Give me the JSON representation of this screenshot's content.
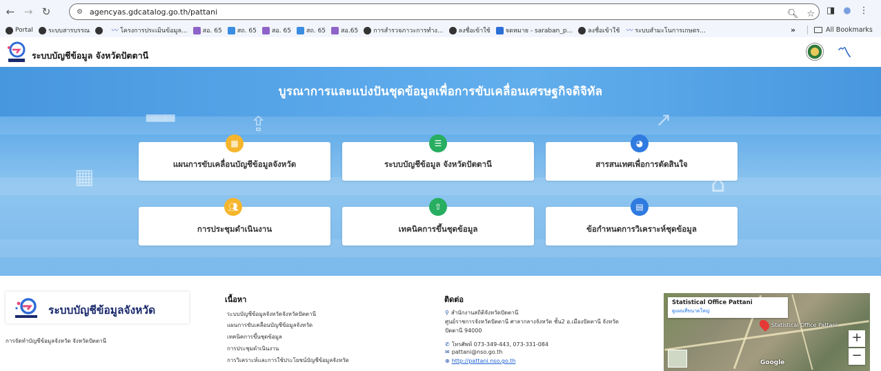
{
  "browser": {
    "url": "agencyas.gdcatalog.go.th/pattani",
    "bookmarks": [
      "Portal",
      "ระบบสารบรรณ",
      "",
      "โครงการประเมินข้อมูล...",
      "สอ. 65",
      "สถ. 65",
      "สอ. 65",
      "สถ. 65",
      "สอ.65",
      "การสำรวจภาวะการทำง...",
      "ลงชื่อเข้าใช้",
      "จดหมาย - saraban_p...",
      "ลงชื่อเข้าใช้",
      "ระบบสำมะโนการเกษตร..."
    ],
    "more_label": "»",
    "all_bookmarks": "All Bookmarks"
  },
  "header": {
    "site_title": "ระบบบัญชีข้อมูล จังหวัดปัตตานี"
  },
  "hero": {
    "title": "บูรณาการและแบ่งปันชุดข้อมูลเพื่อการขับเคลื่อนเศรษฐกิจดิจิทัล",
    "cards": [
      {
        "label": "แผนการขับเคลื่อนบัญชีข้อมูลจังหวัด",
        "icon": "calendar-icon",
        "color": "#f5b62d"
      },
      {
        "label": "ระบบบัญชีข้อมูล จังหวัดปัตตานี",
        "icon": "list-icon",
        "color": "#27ae60"
      },
      {
        "label": "สารสนเทศเพื่อการตัดสินใจ",
        "icon": "pie-chart-icon",
        "color": "#2f7be0"
      },
      {
        "label": "การประชุมดำเนินงาน",
        "icon": "users-icon",
        "color": "#f5b62d"
      },
      {
        "label": "เทคนิคการขึ้นชุดข้อมูล",
        "icon": "file-upload-icon",
        "color": "#27ae60"
      },
      {
        "label": "ข้อกำหนดการวิเคราะห์ชุดข้อมูล",
        "icon": "document-icon",
        "color": "#2f7be0"
      }
    ]
  },
  "footer": {
    "logo_text": "ระบบบัญชีข้อมูลจังหวัด",
    "description": "การจัดทำบัญชีข้อมูลจังหวัด จังหวัดปัตตานี",
    "content_heading": "เนื้อหา",
    "content_links": [
      "ระบบบัญชีข้อมูลจังหวัดจังหวัดปัตตานี",
      "แผนการขับเคลื่อนบัญชีข้อมูลจังหวัด",
      "เทคนิคการขึ้นชุดข้อมูล",
      "การประชุมดำเนินงาน",
      "การวิเคราะห์และการใช้ประโยชน์บัญชีข้อมูลจังหวัด"
    ],
    "contact_heading": "ติดต่อ",
    "contact": {
      "office": "สำนักงานสถิติจังหวัดปัตตานี",
      "address_1": "ศูนย์ราชการจังหวัดปัตตานี ศาลากลางจังหวัด ชั้น2 อ.เมืองปัตตานี จังหวัด",
      "address_2": "ปัตตานี 94000",
      "phone": "โทรศัพท์ 073-349-443, 073-331-084",
      "email": "pattani@nso.go.th",
      "website": "http://pattani.nso.go.th"
    },
    "map": {
      "place_name": "Statistical Office Pattani",
      "link": "ดูแผนที่ขนาดใหญ่",
      "marker_label": "Statistical Office Pattani",
      "zoom_in": "+",
      "zoom_out": "−",
      "brand": "Google"
    }
  }
}
